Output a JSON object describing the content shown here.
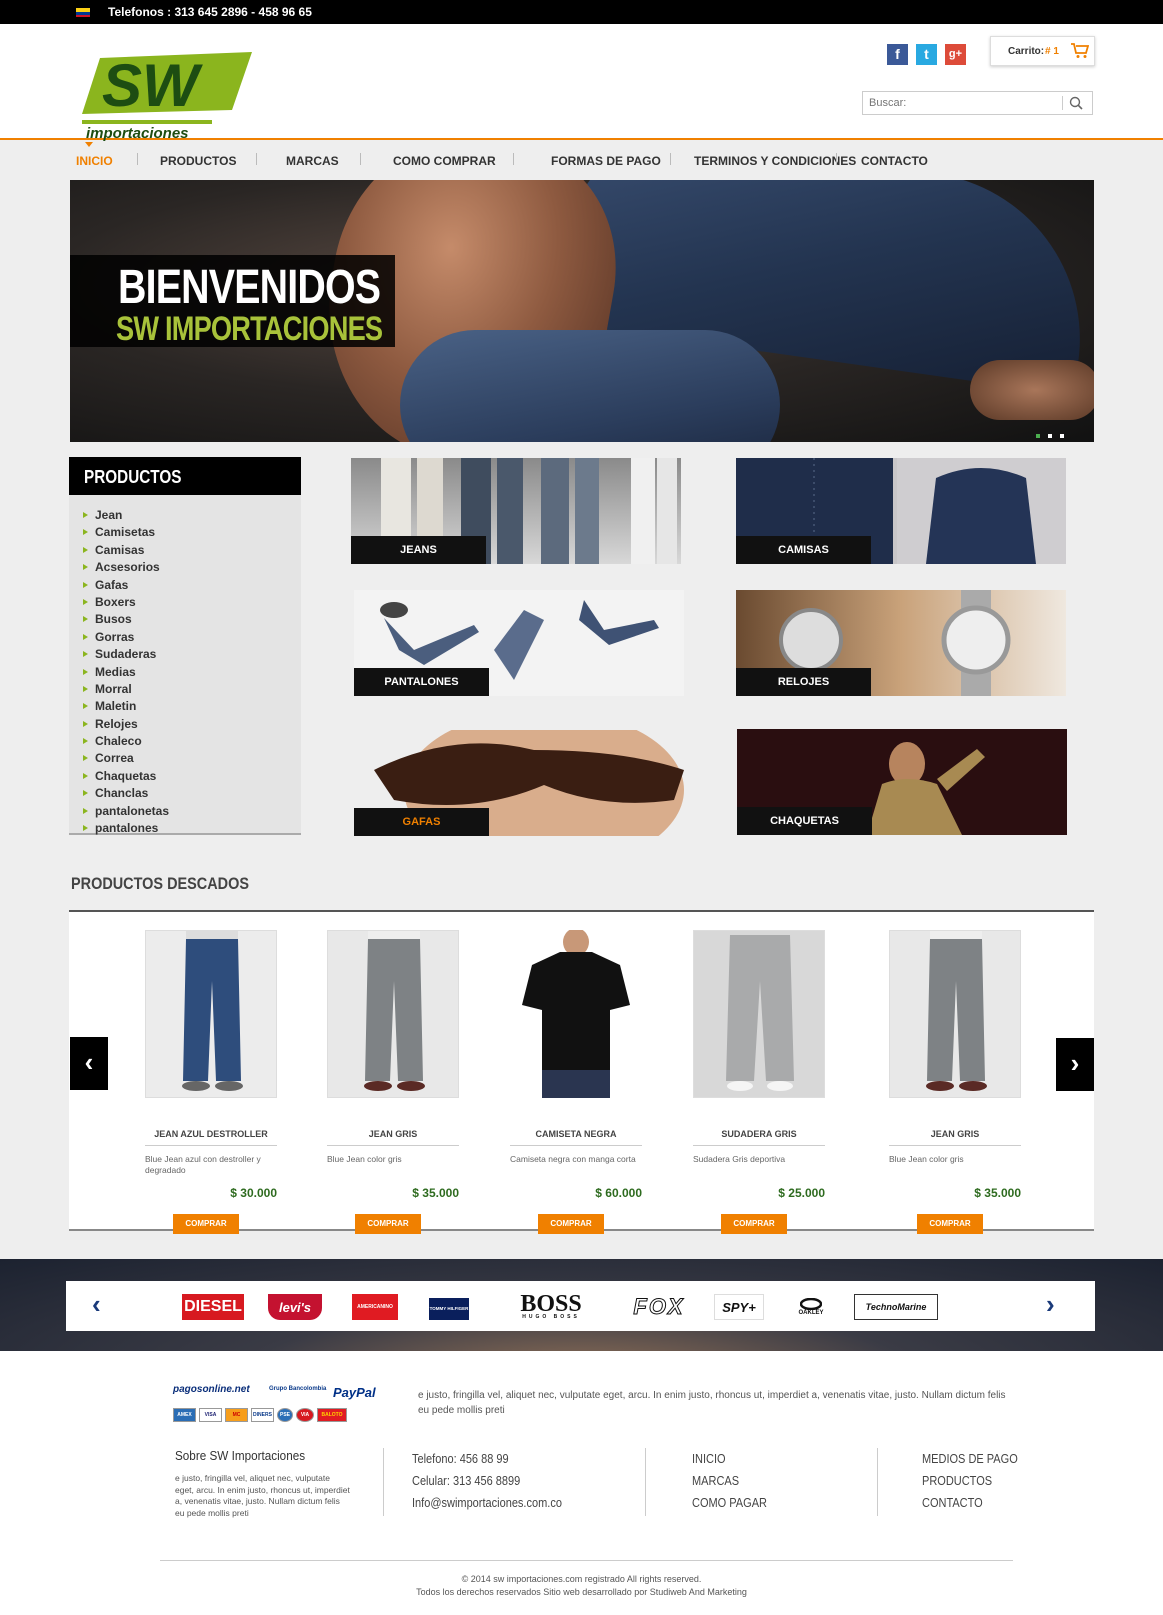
{
  "topbar": {
    "phone": "Telefonos : 313 645 2896  - 458 96 65"
  },
  "header": {
    "logo_text_top": "SW",
    "logo_text_bottom": "importaciones",
    "cart_label": "Carrito:",
    "cart_count": "# 1",
    "search_placeholder": "Buscar:"
  },
  "social": [
    {
      "icon": "facebook-icon",
      "glyph": "f",
      "color": "#3b5998"
    },
    {
      "icon": "twitter-icon",
      "glyph": "t",
      "color": "#29a9e1"
    },
    {
      "icon": "googleplus-icon",
      "glyph": "g+",
      "color": "#dd4b39"
    }
  ],
  "nav": [
    {
      "label": "INICIO",
      "active": true
    },
    {
      "label": "PRODUCTOS"
    },
    {
      "label": "MARCAS"
    },
    {
      "label": "COMO COMPRAR"
    },
    {
      "label": "FORMAS DE PAGO"
    },
    {
      "label": "TERMINOS Y CONDICIONES"
    },
    {
      "label": "CONTACTO"
    }
  ],
  "hero": {
    "line1": "BIENVENIDOS",
    "line2": "SW IMPORTACIONES"
  },
  "sidebar": {
    "title": "PRODUCTOS",
    "items": [
      "Jean",
      "Camisetas",
      "Camisas",
      "Acsesorios",
      "Gafas",
      "Boxers",
      "Busos",
      "Gorras",
      "Sudaderas",
      "Medias",
      "Morral",
      "Maletin",
      "Relojes",
      "Chaleco",
      "Correa",
      "Chaquetas",
      "Chanclas",
      "pantalonetas",
      "pantalones"
    ]
  },
  "categories": [
    {
      "label": "JEANS"
    },
    {
      "label": "CAMISAS"
    },
    {
      "label": "PANTALONES"
    },
    {
      "label": "RELOJES"
    },
    {
      "label": "GAFAS",
      "highlight": "#f08000"
    },
    {
      "label": "CHAQUETAS"
    }
  ],
  "featured": {
    "title": "PRODUCTOS DESCADOS",
    "buy_label": "COMPRAR",
    "products": [
      {
        "name": "JEAN  AZUL DESTROLLER",
        "desc": "Blue Jean azul con destroller y degradado",
        "price": "$ 30.000"
      },
      {
        "name": "JEAN  GRIS",
        "desc": "Blue Jean color gris",
        "price": "$ 35.000"
      },
      {
        "name": "CAMISETA NEGRA",
        "desc": "Camiseta negra con manga corta",
        "price": "$ 60.000"
      },
      {
        "name": "SUDADERA  GRIS",
        "desc": "Sudadera Gris deportiva",
        "price": "$ 25.000"
      },
      {
        "name": "JEAN  GRIS",
        "desc": "Blue Jean color gris",
        "price": "$ 35.000"
      }
    ]
  },
  "brands": [
    "DIESEL",
    "levi's",
    "AMERICANINO",
    "TOMMY HILFIGER",
    "BOSS",
    "FOX",
    "SPY+",
    "OAKLEY",
    "TechnoMarine"
  ],
  "brand_subtitles": {
    "boss": "HUGO BOSS"
  },
  "footer": {
    "pay_brand": "pagosonline.net",
    "pay_bank": "Grupo Bancolombia",
    "pay_paypal": "PayPal",
    "pay_cards": [
      "AMEX",
      "VISA",
      "MC",
      "DINERS",
      "PSE",
      "VIA",
      "BALOTO"
    ],
    "lorem": "e justo, fringilla vel, aliquet nec, vulputate eget, arcu. In enim justo, rhoncus ut, imperdiet a, venenatis vitae, justo. Nullam dictum felis eu pede mollis preti",
    "about_title": "Sobre SW Importaciones",
    "about_text": "e justo, fringilla vel, aliquet nec, vulputate eget, arcu. In enim justo, rhoncus ut, imperdiet a, venenatis vitae, justo. Nullam dictum felis eu pede mollis preti",
    "phone": "Telefono: 456 88 99",
    "cell": "Celular: 313 456 8899",
    "email": "Info@swimportaciones.com.co",
    "links1": [
      "INICIO",
      "MARCAS",
      "COMO PAGAR"
    ],
    "links2": [
      "MEDIOS DE PAGO",
      "PRODUCTOS",
      "CONTACTO"
    ],
    "copy1": "© 2014 sw importaciones.com registrado  All rights reserved.",
    "copy2": "Todos los derechos reservados Sitio web desarrollado por Studiweb And Marketing"
  },
  "colors": {
    "accent": "#f08000",
    "green": "#8bb51e",
    "price": "#2e6b1f"
  }
}
